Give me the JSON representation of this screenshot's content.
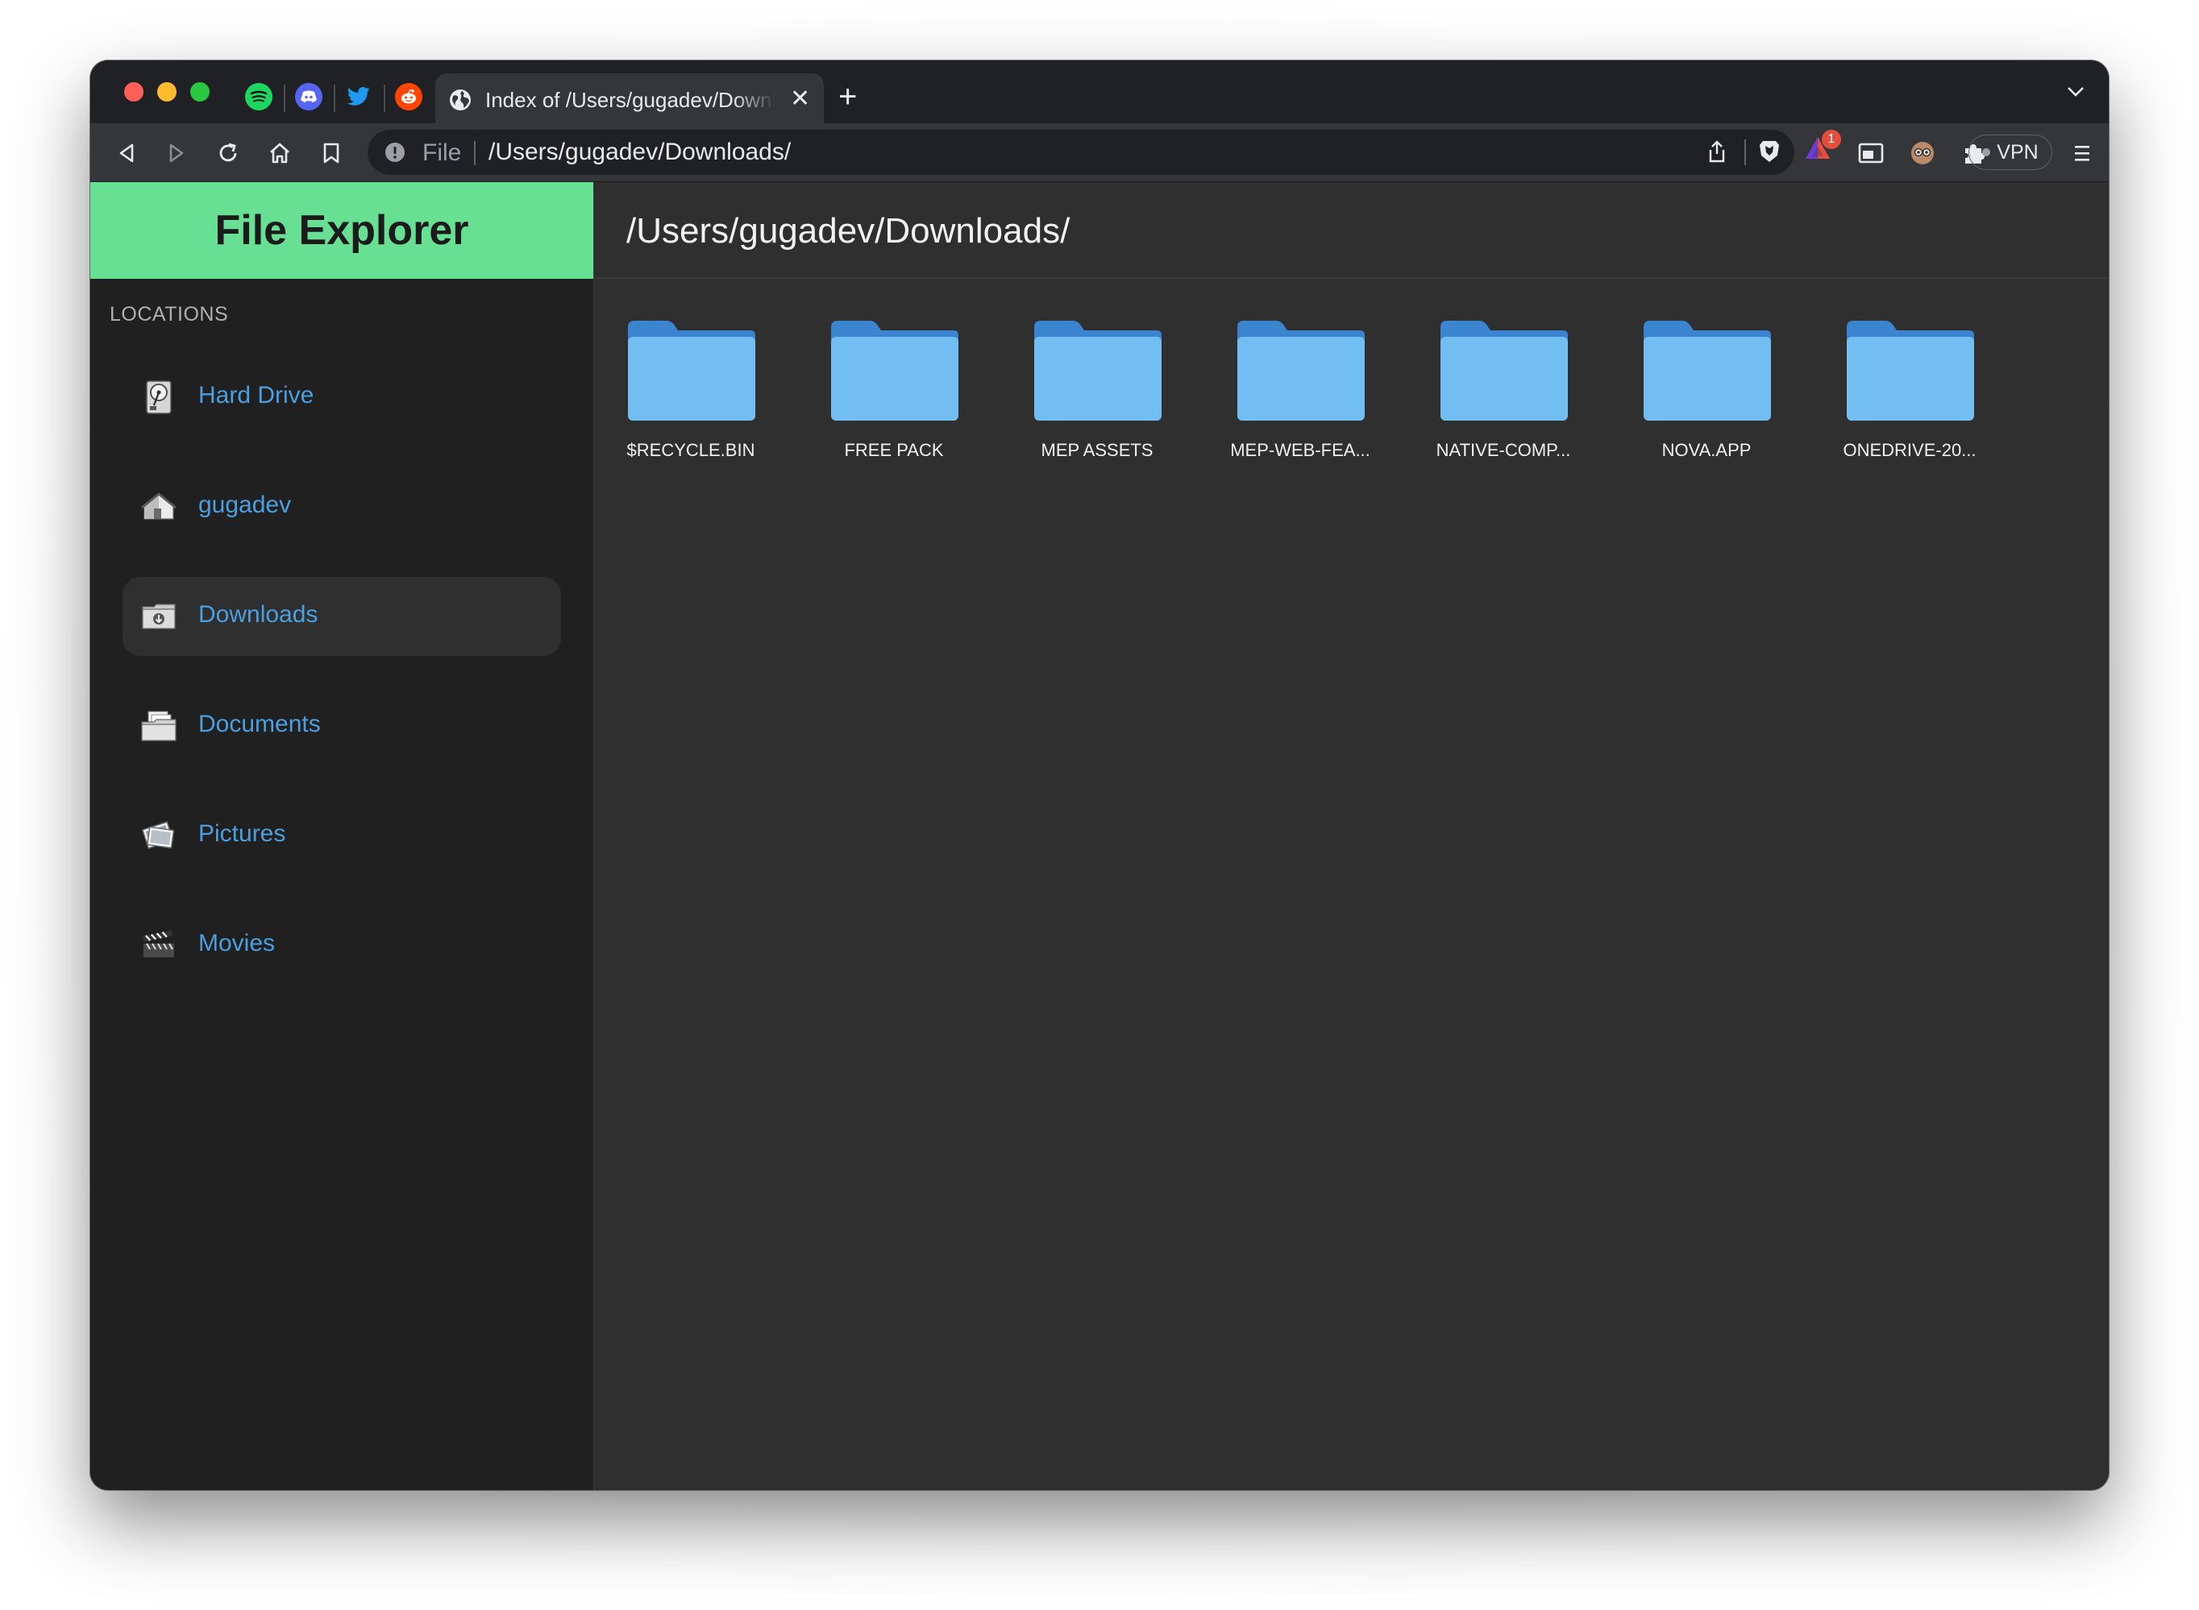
{
  "browser": {
    "pinned_tabs": [
      "spotify-icon",
      "discord-icon",
      "twitter-icon",
      "reddit-icon"
    ],
    "active_tab": {
      "title": "Index of /Users/gugadev/Downloads/"
    },
    "omnibox": {
      "scheme": "File",
      "url": "/Users/gugadev/Downloads/"
    },
    "rewards_badge": "1",
    "vpn_label": "VPN"
  },
  "sidebar": {
    "brand": "File Explorer",
    "heading": "LOCATIONS",
    "items": [
      {
        "label": "Hard Drive",
        "icon": "hard-drive-icon"
      },
      {
        "label": "gugadev",
        "icon": "home-icon"
      },
      {
        "label": "Downloads",
        "icon": "downloads-folder-icon",
        "active": true
      },
      {
        "label": "Documents",
        "icon": "documents-icon"
      },
      {
        "label": "Pictures",
        "icon": "pictures-icon"
      },
      {
        "label": "Movies",
        "icon": "movies-icon"
      }
    ]
  },
  "main": {
    "path": "/Users/gugadev/Downloads/",
    "folders": [
      {
        "name": "$RECYCLE.BIN"
      },
      {
        "name": "FREE PACK"
      },
      {
        "name": "MEP ASSETS"
      },
      {
        "name": "MEP-WEB-FEA..."
      },
      {
        "name": "NATIVE-COMP..."
      },
      {
        "name": "NOVA.APP"
      },
      {
        "name": "ONEDRIVE-20..."
      }
    ]
  },
  "colors": {
    "brand_green": "#68e093",
    "link_blue": "#4a9fe0",
    "folder_light": "#72bdf1",
    "folder_dark": "#3b84d0"
  }
}
